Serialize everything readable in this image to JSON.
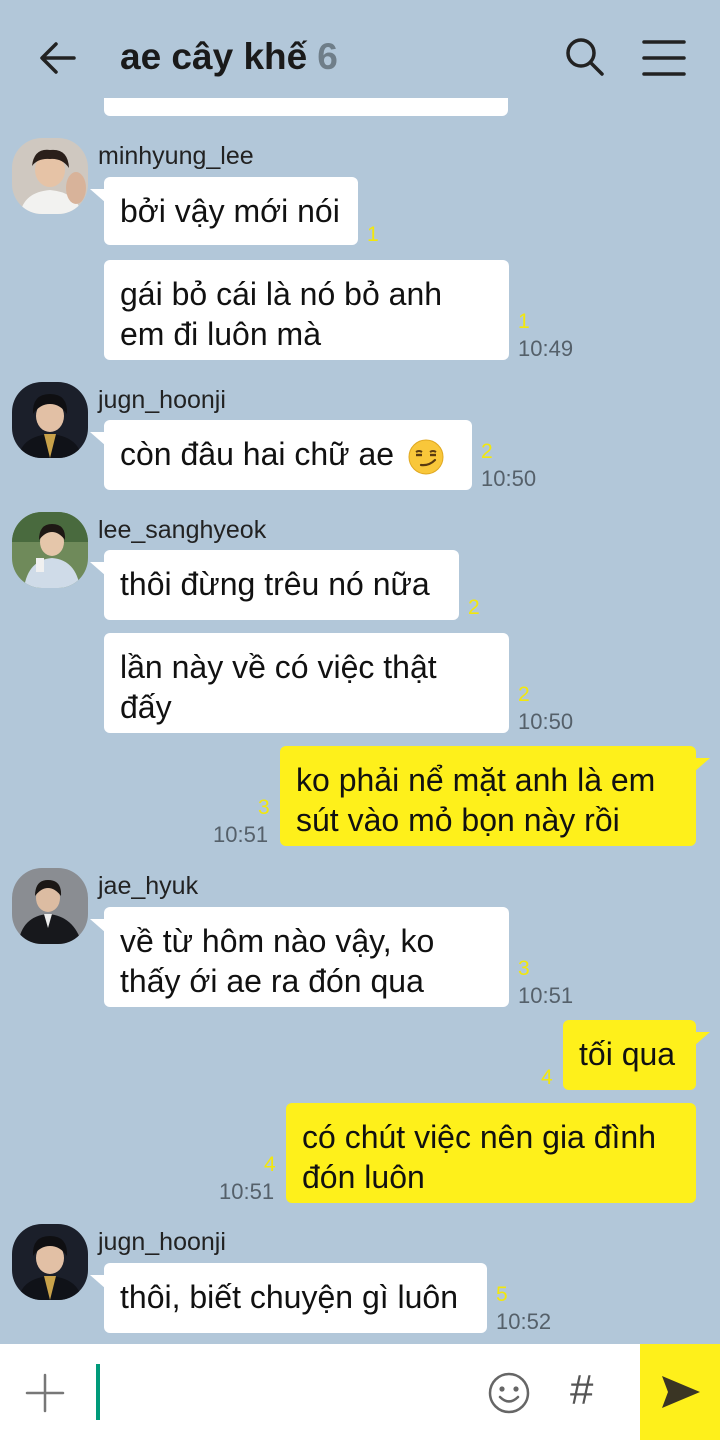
{
  "header": {
    "title": "ae cây khế",
    "member_count": "6"
  },
  "messages": [
    {
      "sender": "minhyung_lee",
      "bubbles": [
        {
          "text": "bởi vậy mới nói",
          "unread": "1",
          "time": ""
        },
        {
          "text": "gái bỏ cái là nó bỏ anh em đi luôn mà",
          "unread": "1",
          "time": "10:49"
        }
      ]
    },
    {
      "sender": "jugn_hoonji",
      "bubbles": [
        {
          "text": "còn đâu hai chữ ae",
          "emoji": "smirk",
          "unread": "2",
          "time": "10:50"
        }
      ]
    },
    {
      "sender": "lee_sanghyeok",
      "bubbles": [
        {
          "text": "thôi đừng trêu nó nữa",
          "unread": "2",
          "time": ""
        },
        {
          "text": "lần này về có việc thật đấy",
          "unread": "2",
          "time": "10:50"
        }
      ]
    },
    {
      "sender": "me",
      "bubbles": [
        {
          "text": "ko phải nể mặt anh là em sút vào mỏ bọn này rồi",
          "unread": "3",
          "time": "10:51"
        }
      ]
    },
    {
      "sender": "jae_hyuk",
      "bubbles": [
        {
          "text": "về từ hôm nào vậy, ko thấy ới ae ra đón qua",
          "unread": "3",
          "time": "10:51"
        }
      ]
    },
    {
      "sender": "me",
      "bubbles": [
        {
          "text": "tối qua",
          "unread": "4",
          "time": ""
        },
        {
          "text": "có chút việc nên gia đình đón luôn",
          "unread": "4",
          "time": "10:51"
        }
      ]
    },
    {
      "sender": "jugn_hoonji",
      "bubbles": [
        {
          "text": "thôi, biết chuyện gì luôn",
          "unread": "5",
          "time": "10:52"
        }
      ]
    }
  ],
  "input_bar": {
    "icons": [
      "plus-icon",
      "emoji-icon",
      "hash-icon",
      "send-icon"
    ],
    "hash_label": "#"
  },
  "colors": {
    "background": "#b2c7d9",
    "my_bubble": "#fef01b",
    "other_bubble": "#ffffff",
    "unread": "#f2e70d",
    "cursor": "#009a7a"
  }
}
